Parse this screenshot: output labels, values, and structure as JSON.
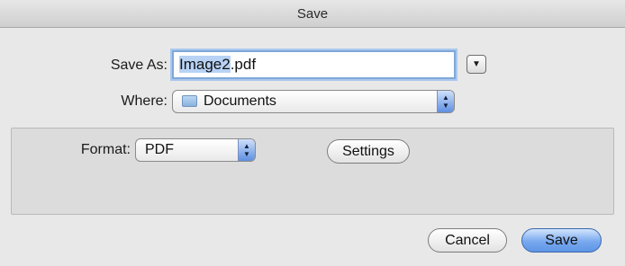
{
  "window": {
    "title": "Save"
  },
  "save_as": {
    "label": "Save As:",
    "filename_selected": "Image2",
    "filename_ext": ".pdf"
  },
  "where": {
    "label": "Where:",
    "value": "Documents"
  },
  "format": {
    "label": "Format:",
    "value": "PDF"
  },
  "buttons": {
    "settings": "Settings",
    "cancel": "Cancel",
    "save": "Save"
  },
  "icons": {
    "disclosure": "chevron-down-icon",
    "folder": "folder-icon",
    "popup_arrows": "up-down-arrows-icon"
  },
  "colors": {
    "accent": "#5e95e6",
    "selection": "#b7d2f5"
  }
}
